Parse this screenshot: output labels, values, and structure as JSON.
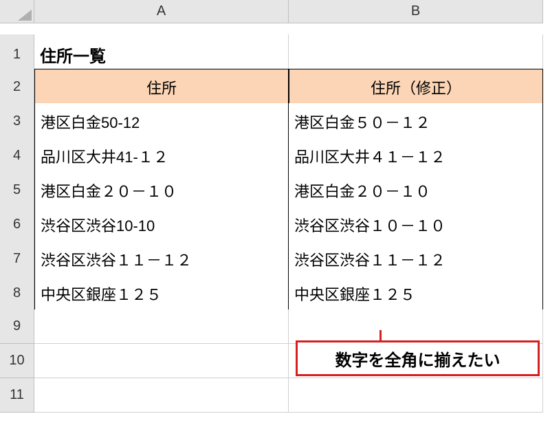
{
  "columns": {
    "A": "A",
    "B": "B"
  },
  "rows": [
    "1",
    "2",
    "3",
    "4",
    "5",
    "6",
    "7",
    "8",
    "9",
    "10",
    "11"
  ],
  "title": "住所一覧",
  "headers": {
    "a": "住所",
    "b": "住所（修正）"
  },
  "data": [
    {
      "a": "港区白金50-12",
      "b": "港区白金５０－１２"
    },
    {
      "a": "品川区大井41-１２",
      "b": "品川区大井４１－１２"
    },
    {
      "a": "港区白金２０－１０",
      "b": "港区白金２０－１０"
    },
    {
      "a": "渋谷区渋谷10-10",
      "b": "渋谷区渋谷１０－１０"
    },
    {
      "a": "渋谷区渋谷１１－１２",
      "b": "渋谷区渋谷１１－１２"
    },
    {
      "a": "中央区銀座１２５",
      "b": "中央区銀座１２５"
    }
  ],
  "callout": "数字を全角に揃えたい"
}
